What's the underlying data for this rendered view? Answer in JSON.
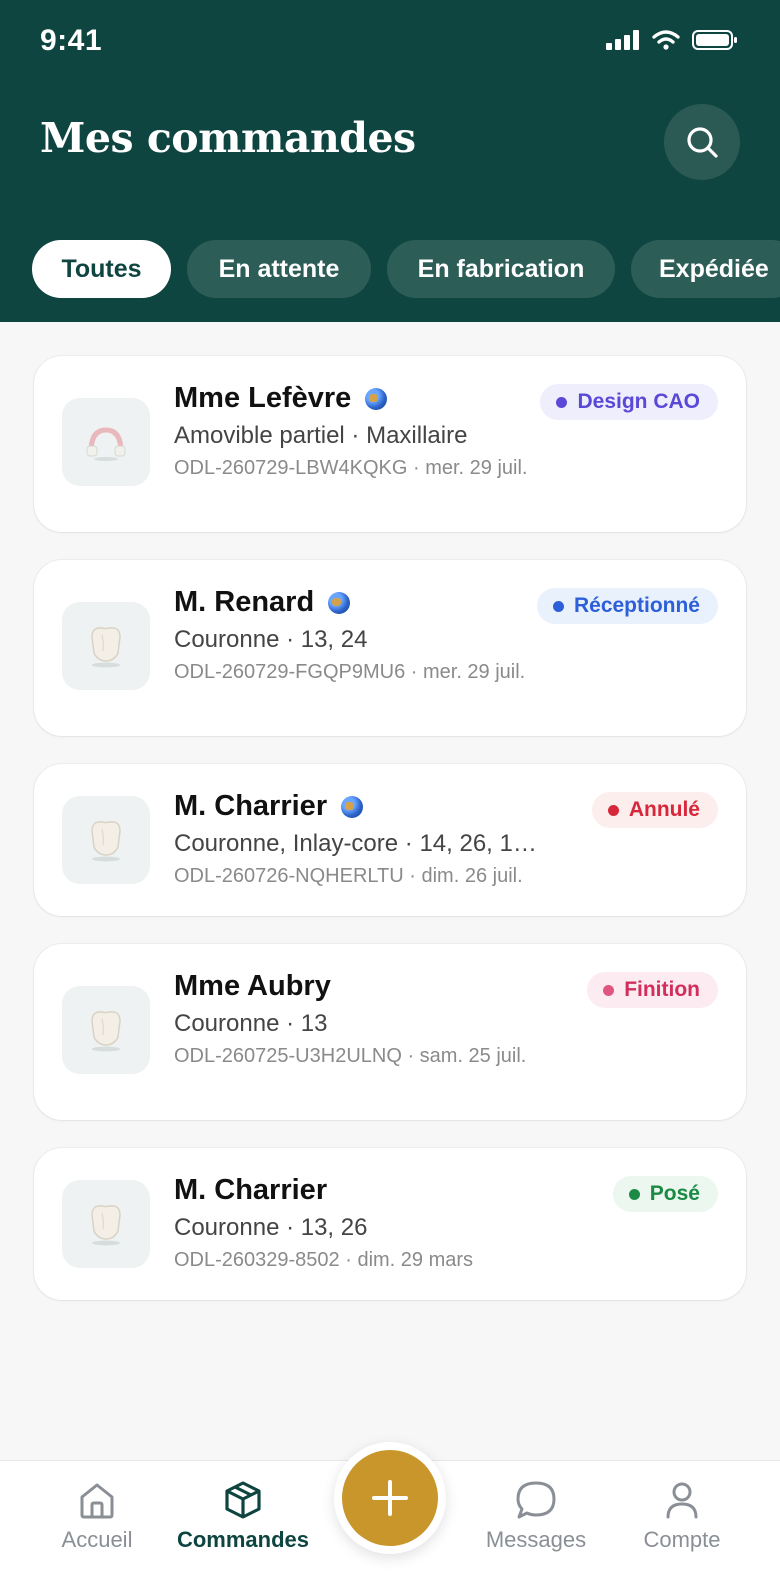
{
  "status": {
    "time": "9:41"
  },
  "header": {
    "title": "Mes commandes"
  },
  "filters": [
    {
      "label": "Toutes",
      "active": true
    },
    {
      "label": "En attente",
      "active": false
    },
    {
      "label": "En fabrication",
      "active": false
    },
    {
      "label": "Expédiée",
      "active": false
    }
  ],
  "orders": [
    {
      "name": "Mme Lefèvre",
      "globe": true,
      "subtitle": "Amovible partiel · Maxillaire",
      "meta": "ODL-260729-LBW4KQKG · mer. 29 juil.",
      "status": "Design CAO",
      "status_color": "#5b48d6",
      "status_bg": "#eeeefd",
      "thumb": "partial-denture-icon"
    },
    {
      "name": "M. Renard",
      "globe": true,
      "subtitle": "Couronne · 13, 24",
      "meta": "ODL-260729-FGQP9MU6 · mer. 29 juil.",
      "status": "Réceptionné",
      "status_color": "#2c5fd8",
      "status_bg": "#e9f1fd",
      "thumb": "crown-icon"
    },
    {
      "name": "M. Charrier",
      "globe": true,
      "subtitle": "Couronne, Inlay-core · 14, 26, 1…",
      "meta": "ODL-260726-NQHERLTU · dim. 26 juil.",
      "status": "Annulé",
      "status_color": "#d6283a",
      "status_bg": "#fdeeee",
      "thumb": "crown-icon"
    },
    {
      "name": "Mme Aubry",
      "globe": false,
      "subtitle": "Couronne · 13",
      "meta": "ODL-260725-U3H2ULNQ · sam. 25 juil.",
      "status": "Finition",
      "status_color": "#d12e5e",
      "status_bg": "#fcecf1",
      "thumb": "crown-icon"
    },
    {
      "name": "M. Charrier",
      "globe": false,
      "subtitle": "Couronne · 13, 26",
      "meta": "ODL-260329-8502 · dim. 29 mars",
      "status": "Posé",
      "status_color": "#1a8a44",
      "status_bg": "#ebf7ef",
      "thumb": "crown-icon"
    }
  ],
  "tabbar": {
    "items": [
      {
        "label": "Accueil",
        "icon": "home-icon",
        "active": false
      },
      {
        "label": "Commandes",
        "icon": "box-icon",
        "active": true
      },
      {
        "label": "Messages",
        "icon": "chat-bubble-icon",
        "active": false
      },
      {
        "label": "Compte",
        "icon": "user-icon",
        "active": false
      }
    ],
    "fab_icon": "plus-icon"
  },
  "colors": {
    "brand": "#0f4540",
    "accent": "#c9962b"
  }
}
